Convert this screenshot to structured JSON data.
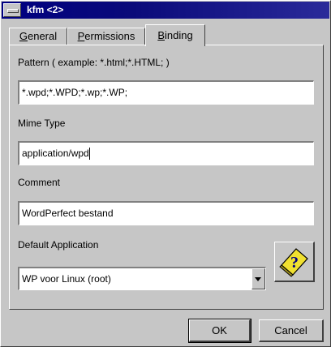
{
  "window": {
    "title": "kfm <2>"
  },
  "tabs": [
    {
      "label": "General",
      "mnemonic": "G"
    },
    {
      "label": "Permissions",
      "mnemonic": "P"
    },
    {
      "label": "Binding",
      "mnemonic": "B",
      "active": true
    }
  ],
  "binding": {
    "pattern_label": "Pattern ( example: *.html;*.HTML; )",
    "pattern_value": "*.wpd;*.WPD;*.wp;*.WP;",
    "mime_label": "Mime Type",
    "mime_value": "application/wpd",
    "comment_label": "Comment",
    "comment_value": "WordPerfect bestand",
    "default_app_label": "Default Application",
    "default_app_value": "WP voor Linux (root)",
    "icon_button": "help-document-icon"
  },
  "buttons": {
    "ok": "OK",
    "cancel": "Cancel"
  },
  "colors": {
    "titlebar": "#000080",
    "face": "#c6c6c6",
    "icon_yellow": "#f0e030"
  }
}
